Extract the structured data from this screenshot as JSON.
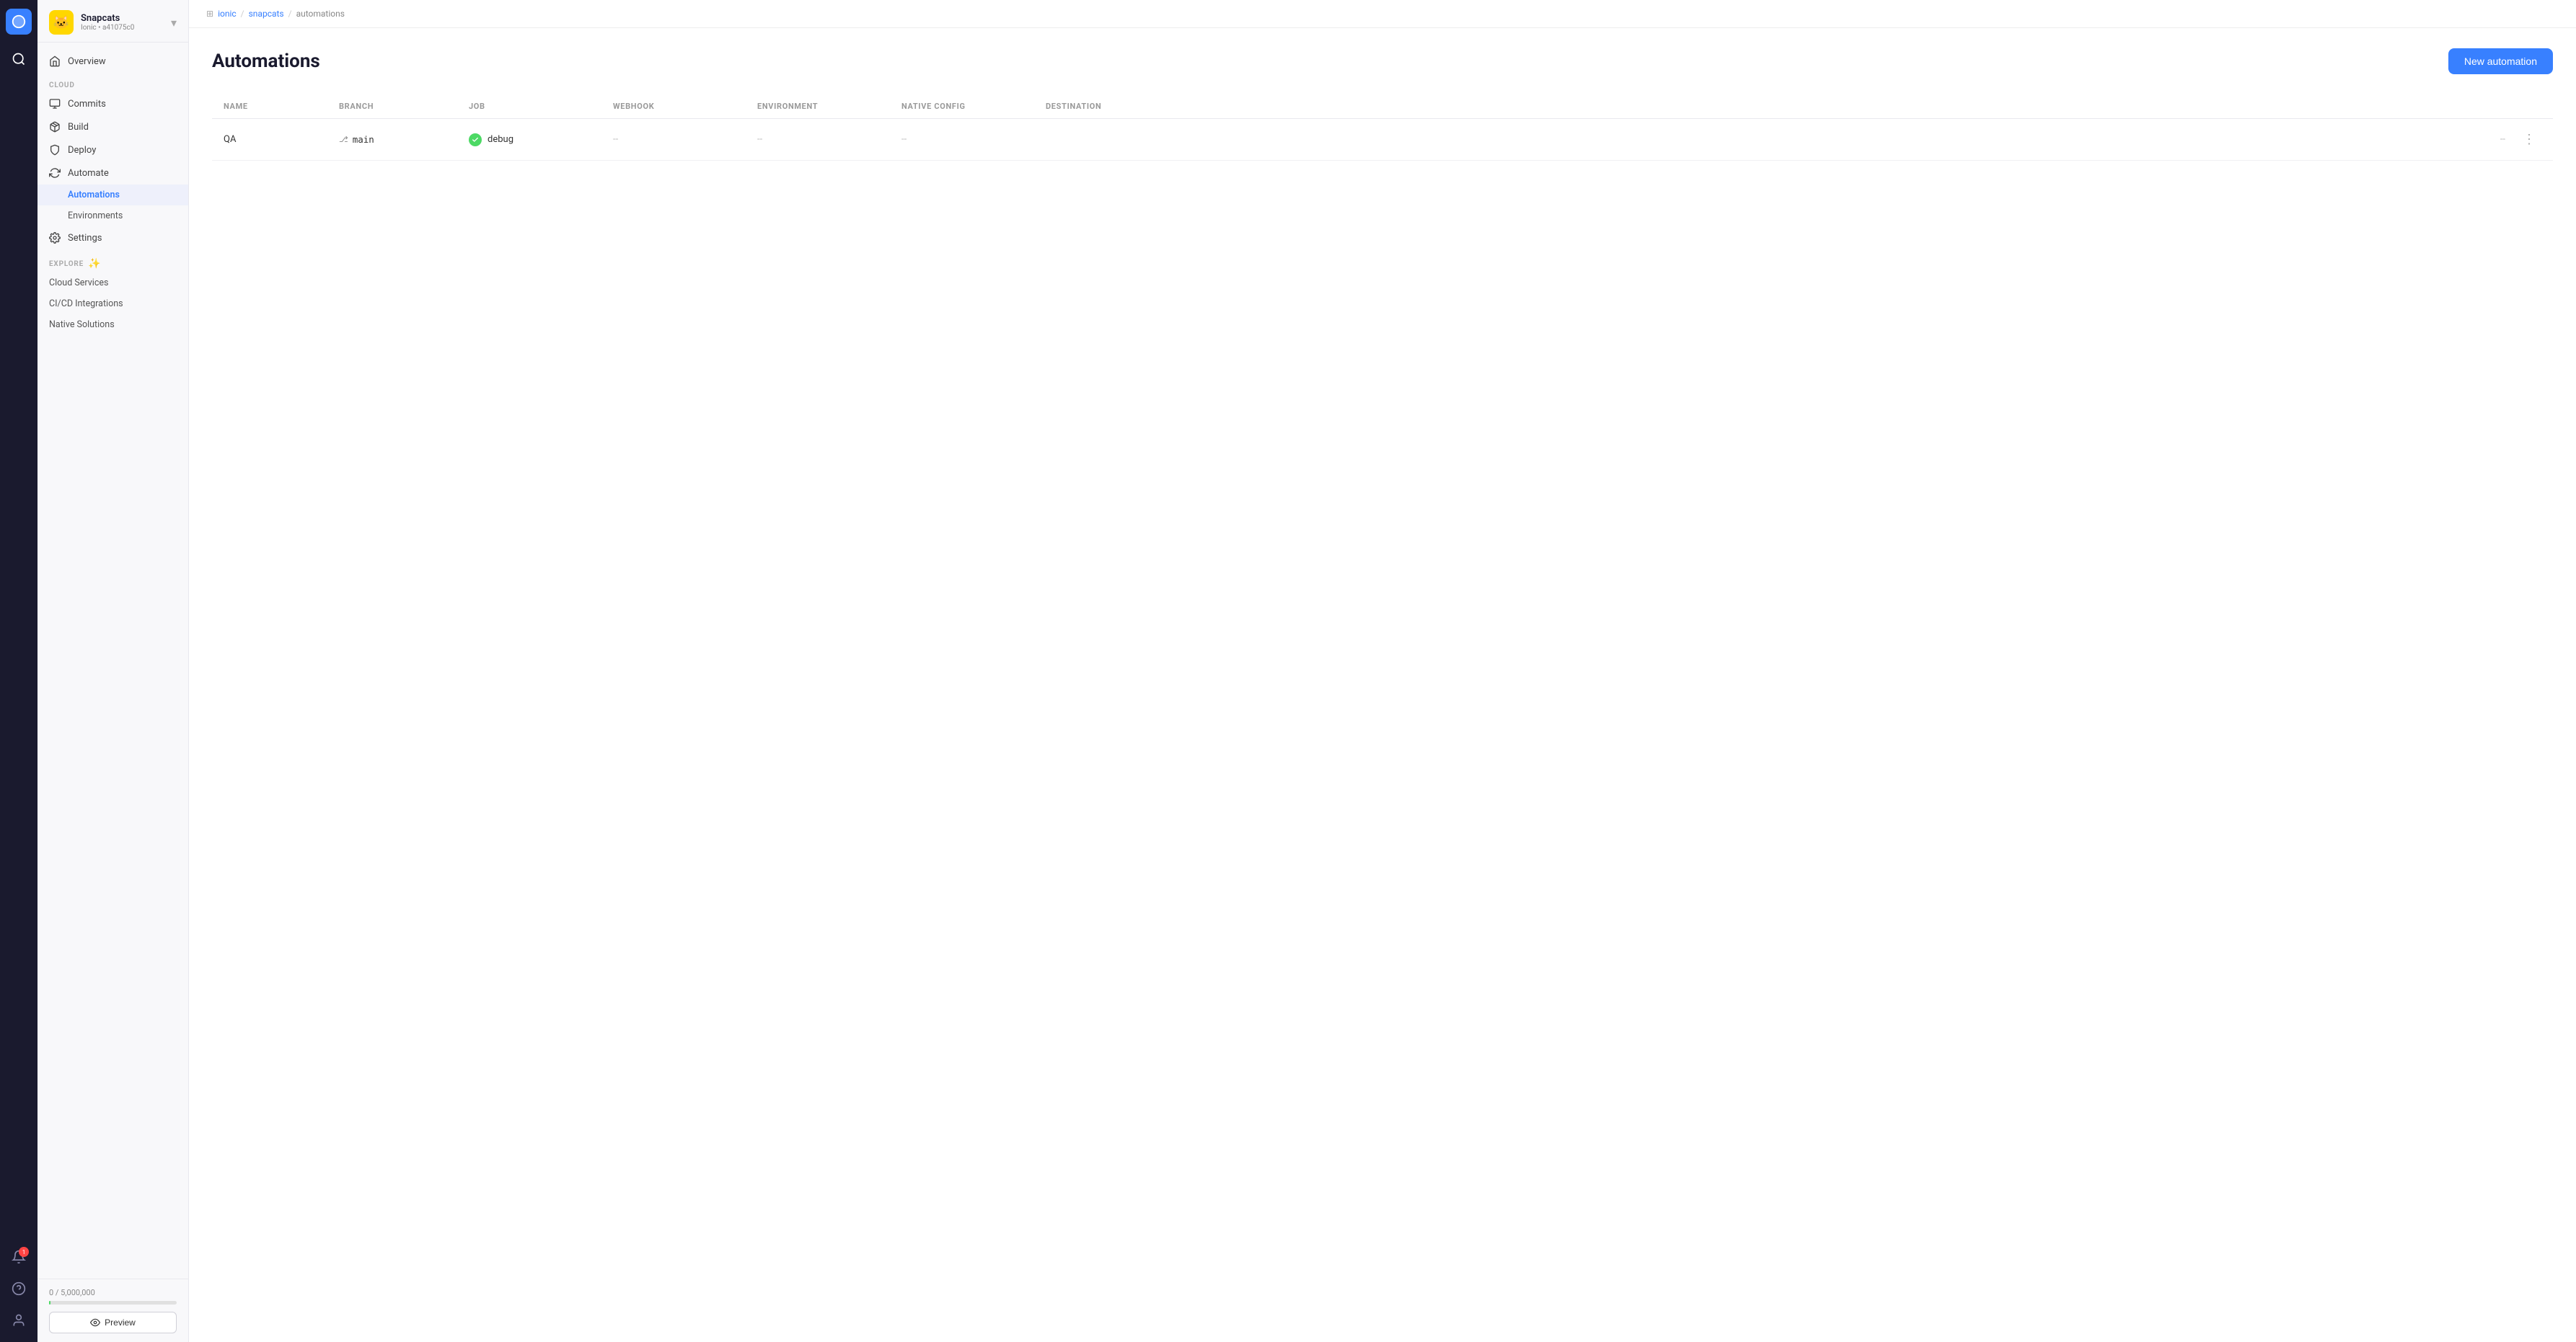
{
  "rail": {
    "logo_label": "Snapcats",
    "notification_count": "1"
  },
  "sidebar": {
    "app_name": "Snapcats",
    "app_id": "Ionic • a41075c0",
    "nav_items": [
      {
        "id": "overview",
        "label": "Overview",
        "icon": "home"
      },
      {
        "id": "commits",
        "label": "Commits",
        "icon": "box"
      },
      {
        "id": "build",
        "label": "Build",
        "icon": "package"
      },
      {
        "id": "deploy",
        "label": "Deploy",
        "icon": "shield"
      },
      {
        "id": "automate",
        "label": "Automate",
        "icon": "refresh"
      },
      {
        "id": "settings",
        "label": "Settings",
        "icon": "gear"
      }
    ],
    "sub_items": [
      {
        "id": "automations",
        "label": "Automations",
        "active": true
      },
      {
        "id": "environments",
        "label": "Environments",
        "active": false
      }
    ],
    "section_cloud_label": "CLOUD",
    "section_explore_label": "EXPLORE",
    "explore_items": [
      {
        "id": "cloud-services",
        "label": "Cloud Services"
      },
      {
        "id": "cicd-integrations",
        "label": "CI/CD Integrations"
      },
      {
        "id": "native-solutions",
        "label": "Native Solutions"
      }
    ],
    "usage_label": "0 / 5,000,000",
    "preview_label": "Preview"
  },
  "breadcrumb": {
    "items": [
      "ionic",
      "snapcats",
      "automations"
    ],
    "separator": "/"
  },
  "page": {
    "title": "Automations",
    "new_button_label": "New automation"
  },
  "table": {
    "columns": [
      "NAME",
      "BRANCH",
      "JOB",
      "WEBHOOK",
      "ENVIRONMENT",
      "NATIVE CONFIG",
      "DESTINATION"
    ],
    "rows": [
      {
        "name": "QA",
        "branch": "main",
        "job": "debug",
        "webhook": "--",
        "environment": "--",
        "native_config": "--",
        "destination": "--"
      }
    ]
  }
}
